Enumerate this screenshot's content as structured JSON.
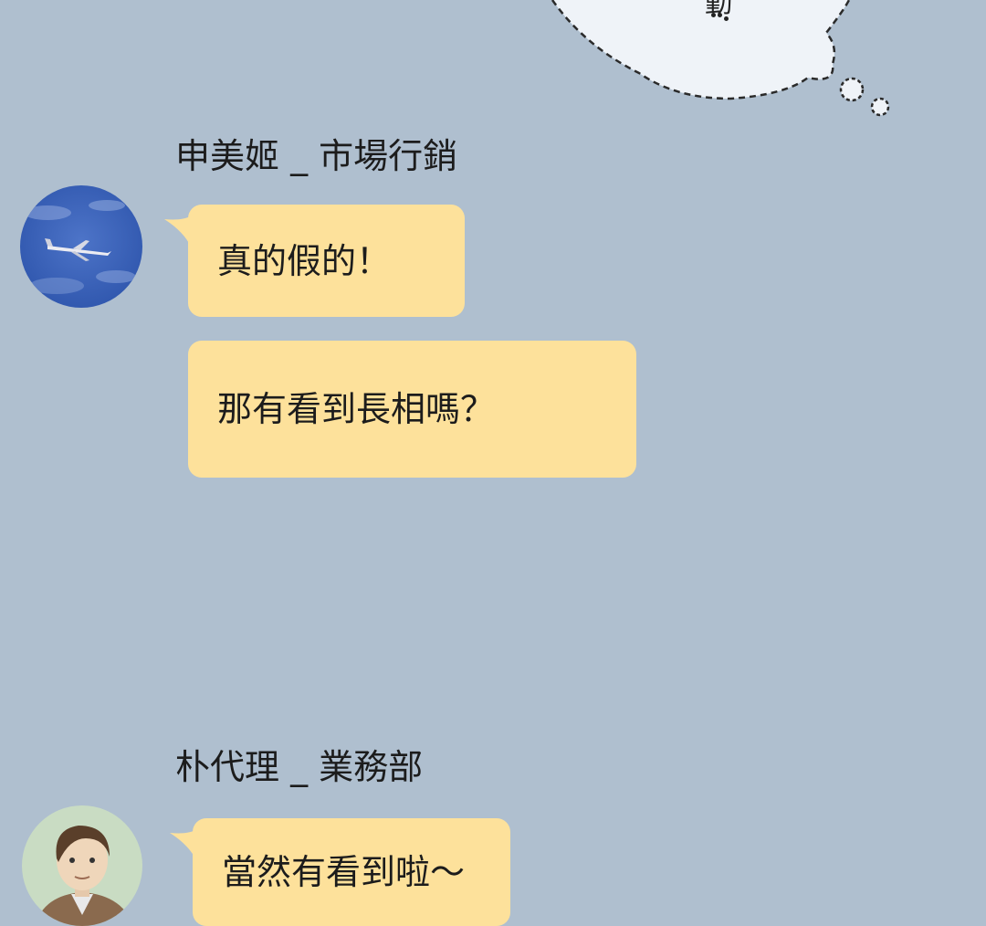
{
  "thought_bubble": {
    "text": "勤",
    "ellipsis": "⋮"
  },
  "messages": [
    {
      "sender": "申美姬 _ 市場行銷",
      "avatar_icon": "airplane-sky-avatar",
      "bubbles": [
        "真的假的！",
        "那有看到長相嗎？"
      ]
    },
    {
      "sender": "朴代理 _ 業務部",
      "avatar_icon": "man-portrait-avatar",
      "bubbles": [
        "當然有看到啦～"
      ]
    }
  ],
  "colors": {
    "background": "#afbfcf",
    "bubble": "#fde19b",
    "thought_fill": "#eff3f8",
    "text": "#1c1c1c"
  }
}
